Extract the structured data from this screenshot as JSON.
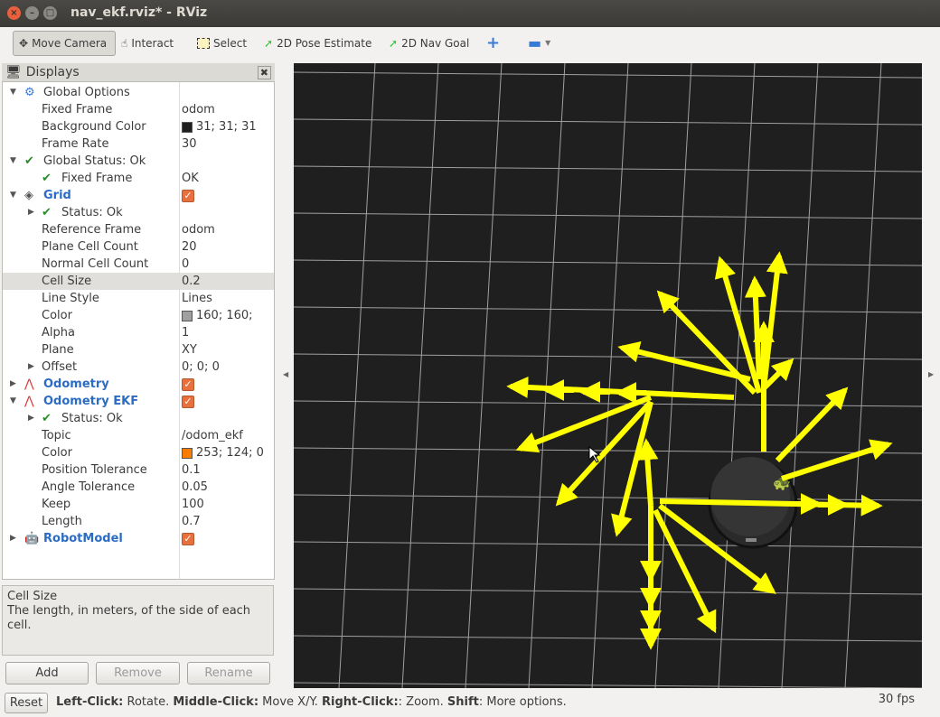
{
  "window": {
    "title": "nav_ekf.rviz* - RViz"
  },
  "toolbar": {
    "move_camera": "Move Camera",
    "interact": "Interact",
    "select": "Select",
    "pose_estimate": "2D Pose Estimate",
    "nav_goal": "2D Nav Goal"
  },
  "displays": {
    "title": "Displays",
    "rows": [
      {
        "k": "Global Options",
        "v": "",
        "indent": 0,
        "tri": "▼",
        "icon": "gear",
        "style": ""
      },
      {
        "k": "Fixed Frame",
        "v": "odom",
        "indent": 1
      },
      {
        "k": "Background Color",
        "v": "31; 31; 31",
        "indent": 1,
        "swatch": "#1f1f1f"
      },
      {
        "k": "Frame Rate",
        "v": "30",
        "indent": 1
      },
      {
        "k": "Global Status: Ok",
        "v": "",
        "indent": 0,
        "tri": "▼",
        "icon": "check"
      },
      {
        "k": "Fixed Frame",
        "v": "OK",
        "indent": 1,
        "icon": "check"
      },
      {
        "k": "Grid",
        "v": "",
        "indent": 0,
        "tri": "▼",
        "icon": "grid",
        "style": "blue",
        "checkbox": true
      },
      {
        "k": "Status: Ok",
        "v": "",
        "indent": 1,
        "tri": "▶",
        "icon": "check"
      },
      {
        "k": "Reference Frame",
        "v": "odom",
        "indent": 1
      },
      {
        "k": "Plane Cell Count",
        "v": "20",
        "indent": 1
      },
      {
        "k": "Normal Cell Count",
        "v": "0",
        "indent": 1
      },
      {
        "k": "Cell Size",
        "v": "0.2",
        "indent": 1,
        "selected": true
      },
      {
        "k": "Line Style",
        "v": "Lines",
        "indent": 1
      },
      {
        "k": "Color",
        "v": "160; 160;",
        "indent": 1,
        "swatch": "#a0a0a0"
      },
      {
        "k": "Alpha",
        "v": "1",
        "indent": 1
      },
      {
        "k": "Plane",
        "v": "XY",
        "indent": 1
      },
      {
        "k": "Offset",
        "v": "0; 0; 0",
        "indent": 1,
        "tri": "▶"
      },
      {
        "k": "Odometry",
        "v": "",
        "indent": 0,
        "tri": "▶",
        "icon": "odom",
        "style": "blue",
        "checkbox": true
      },
      {
        "k": "Odometry EKF",
        "v": "",
        "indent": 0,
        "tri": "▼",
        "icon": "odom",
        "style": "blue",
        "checkbox": true
      },
      {
        "k": "Status: Ok",
        "v": "",
        "indent": 1,
        "tri": "▶",
        "icon": "check"
      },
      {
        "k": "Topic",
        "v": "/odom_ekf",
        "indent": 1
      },
      {
        "k": "Color",
        "v": "253; 124; 0",
        "indent": 1,
        "swatch": "#fd7c00"
      },
      {
        "k": "Position Tolerance",
        "v": "0.1",
        "indent": 1
      },
      {
        "k": "Angle Tolerance",
        "v": "0.05",
        "indent": 1
      },
      {
        "k": "Keep",
        "v": "100",
        "indent": 1
      },
      {
        "k": "Length",
        "v": "0.7",
        "indent": 1
      },
      {
        "k": "RobotModel",
        "v": "",
        "indent": 0,
        "tri": "▶",
        "icon": "robot",
        "style": "blue",
        "checkbox": true
      }
    ]
  },
  "description": {
    "title": "Cell Size",
    "text": "The length, in meters, of the side of each cell."
  },
  "buttons": {
    "add": "Add",
    "remove": "Remove",
    "rename": "Rename"
  },
  "status": {
    "reset": "Reset",
    "b1": "Left-Click:",
    "t1": " Rotate. ",
    "b2": "Middle-Click:",
    "t2": " Move X/Y. ",
    "b3": "Right-Click:",
    "t3": ": Zoom. ",
    "b4": "Shift",
    "t4": ": More options.",
    "fps": "30 fps"
  },
  "colors": {
    "arrow": "#ffff00",
    "background": "#1f1f1f",
    "grid": "#a0a0a0"
  }
}
